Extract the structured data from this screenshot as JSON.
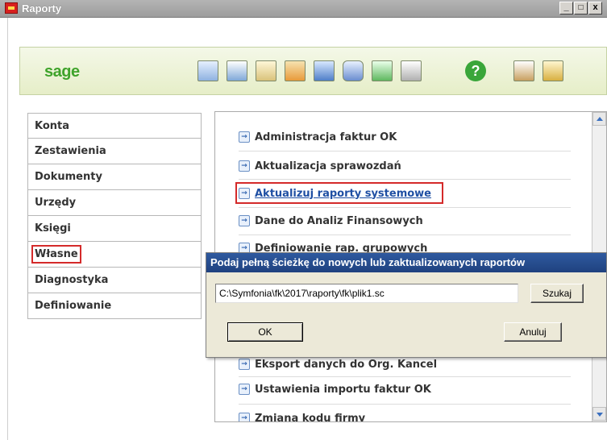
{
  "window": {
    "title": "Raporty",
    "controls": [
      "_",
      "□",
      "x"
    ]
  },
  "toolbar": {
    "logo": "sage",
    "icons": [
      "ledger-icon",
      "chart-window-icon",
      "vat-document-icon",
      "register-icon",
      "grid-table-icon",
      "tools-icon",
      "line-chart-icon",
      "report-list-icon",
      "help-icon",
      "mail-icon",
      "phone-icon"
    ],
    "help_label": "?"
  },
  "nav": {
    "items": [
      {
        "label": "Konta",
        "underline_index": 3
      },
      {
        "label": "Zestawienia"
      },
      {
        "label": "Dokumenty"
      },
      {
        "label": "Urzędy"
      },
      {
        "label": "Księgi"
      },
      {
        "label": "Własne",
        "highlighted": true
      },
      {
        "label": "Diagnostyka"
      },
      {
        "label": "Definiowanie"
      }
    ]
  },
  "reports": {
    "items": [
      {
        "label": "Administracja faktur OK"
      },
      {
        "label": "Aktualizacja sprawozdań"
      },
      {
        "label": "Aktualizuj raporty systemowe",
        "active": true
      },
      {
        "label": "Dane do Analiz Finansowych"
      },
      {
        "label": "Definiowanie rap. grupowych"
      },
      {
        "label": "Eksport danych do Org. Kancel"
      },
      {
        "label": "Ustawienia importu faktur OK"
      },
      {
        "label": "Zmiana kodu firmy"
      }
    ]
  },
  "dialog": {
    "title": "Podaj pełną ścieżkę do nowych lub zaktualizowanych raportów",
    "path_value": "C:\\Symfonia\\fk\\2017\\raporty\\fk\\plik1.sc",
    "browse_label": "Szukaj",
    "ok_label": "OK",
    "cancel_label": "Anuluj"
  },
  "colors": {
    "accent": "#1f4fa3",
    "highlight_box": "#d42a2a",
    "brand_green": "#3fa32b",
    "dialog_title": "#2f5a9f"
  }
}
